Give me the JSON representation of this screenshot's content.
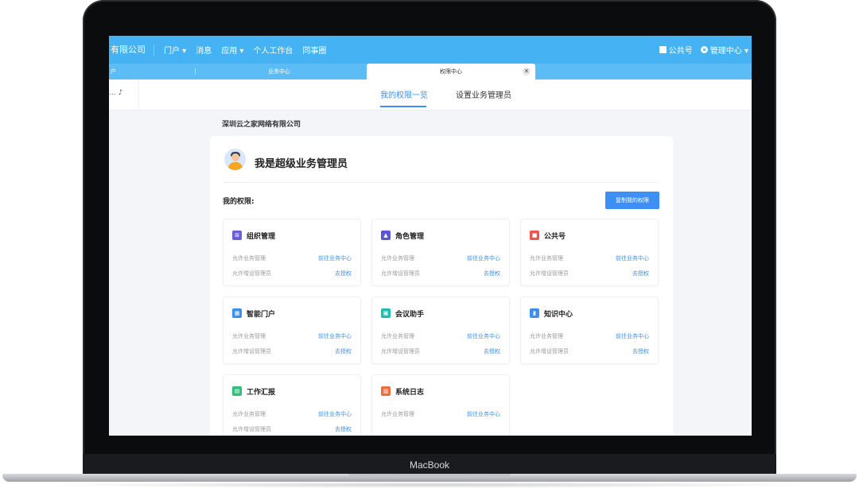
{
  "brand": "有限公司",
  "nav": {
    "items": [
      "门户 ▾",
      "消息",
      "应用 ▾",
      "个人工作台",
      "同事圈"
    ],
    "right": [
      "公共号",
      "管理中心 ▾"
    ]
  },
  "tabs": {
    "t1": "户",
    "t2": "业务中心",
    "t3": "权限中心",
    "close": "✕"
  },
  "subtabs": {
    "left": "... ♪",
    "active": "我的权限一览",
    "inactive": "设置业务管理员"
  },
  "company": "深圳云之家网络有限公司",
  "role_title": "我是超级业务管理员",
  "perm_label": "我的权限:",
  "copy_button": "复制我的权限",
  "modules": [
    {
      "title": "组织管理",
      "icon": "org-icon",
      "color": "#6c5fd6",
      "glyph": "⊞",
      "row1_label": "允许业务管理",
      "row1_link": "前往业务中心",
      "row2_label": "允许增设管理员",
      "row2_link": "去授权"
    },
    {
      "title": "角色管理",
      "icon": "role-icon",
      "color": "#5a57d8",
      "glyph": "▲",
      "row1_label": "允许业务管理",
      "row1_link": "前往业务中心",
      "row2_label": "允许增设管理员",
      "row2_link": "去授权"
    },
    {
      "title": "公共号",
      "icon": "public-account-icon",
      "color": "#f0524f",
      "glyph": "■",
      "row1_label": "允许业务管理",
      "row1_link": "前往业务中心",
      "row2_label": "允许增设管理员",
      "row2_link": "去授权"
    },
    {
      "title": "智能门户",
      "icon": "portal-icon",
      "color": "#3c8ff0",
      "glyph": "▦",
      "row1_label": "允许业务管理",
      "row1_link": "前往业务中心",
      "row2_label": "允许增设管理员",
      "row2_link": "去授权"
    },
    {
      "title": "会议助手",
      "icon": "meeting-icon",
      "color": "#1fbfae",
      "glyph": "▣",
      "row1_label": "允许业务管理",
      "row1_link": "前往业务中心",
      "row2_label": "允许增设管理员",
      "row2_link": "去授权"
    },
    {
      "title": "知识中心",
      "icon": "knowledge-icon",
      "color": "#3c8ff0",
      "glyph": "▮",
      "row1_label": "允许业务管理",
      "row1_link": "前往业务中心",
      "row2_label": "允许增设管理员",
      "row2_link": "去授权"
    },
    {
      "title": "工作汇报",
      "icon": "report-icon",
      "color": "#2fbf76",
      "glyph": "▤",
      "row1_label": "允许业务管理",
      "row1_link": "前往业务中心",
      "row2_label": "允许增设管理员",
      "row2_link": "去授权"
    },
    {
      "title": "系统日志",
      "icon": "log-icon",
      "color": "#f26b3a",
      "glyph": "▥",
      "row1_label": "允许业务管理",
      "row1_link": "前往业务中心"
    }
  ],
  "laptop_label": "MacBook"
}
